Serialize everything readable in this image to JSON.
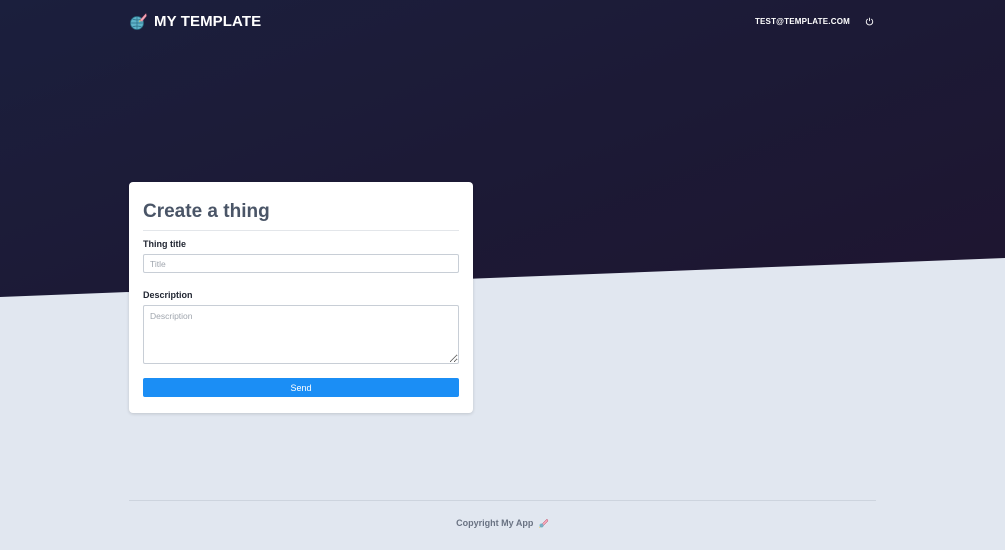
{
  "header": {
    "brand_title": "MY TEMPLATE",
    "brand_icon": "globe-rocket-logo",
    "user_email": "TEST@TEMPLATE.COM",
    "logout_icon": "power-icon"
  },
  "form": {
    "title": "Create a thing",
    "title_label": "Thing title",
    "title_placeholder": "Title",
    "title_value": "",
    "description_label": "Description",
    "description_placeholder": "Description",
    "description_value": "",
    "submit_label": "Send"
  },
  "footer": {
    "text": "Copyright My App",
    "icon": "rocket-logo"
  },
  "colors": {
    "hero_background": "#1c1a36",
    "page_background": "#e1e7f0",
    "primary_button": "#1b8ef5",
    "card_title": "#4a5567"
  }
}
